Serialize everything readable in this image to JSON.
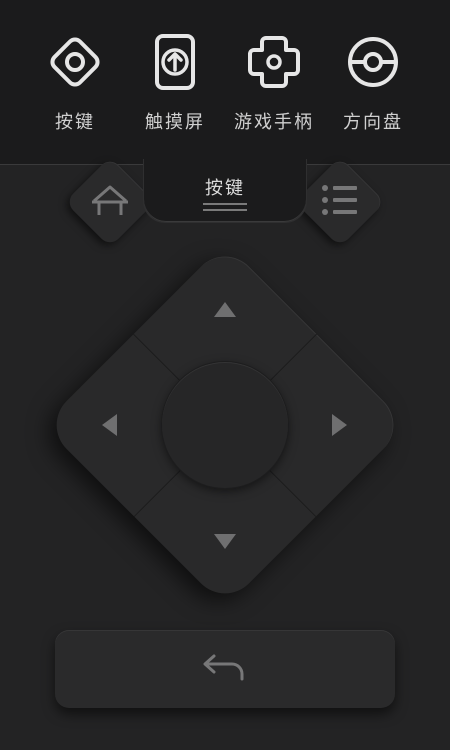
{
  "modes": [
    {
      "label": "按键",
      "icon": "diamond-target-icon"
    },
    {
      "label": "触摸屏",
      "icon": "touch-upload-icon"
    },
    {
      "label": "游戏手柄",
      "icon": "gamepad-cross-icon"
    },
    {
      "label": "方向盘",
      "icon": "steering-wheel-icon"
    }
  ],
  "active_tab": {
    "label": "按键"
  },
  "controls": {
    "home": {
      "icon": "home-icon"
    },
    "menu": {
      "icon": "menu-list-icon"
    },
    "dpad": {
      "up": "arrow-up-icon",
      "down": "arrow-down-icon",
      "left": "arrow-left-icon",
      "right": "arrow-right-icon",
      "center": "ok-button"
    },
    "back": {
      "icon": "back-arrow-icon"
    }
  },
  "colors": {
    "background": "#232324",
    "topbar": "#1b1b1c",
    "icon": "#e6e6e6",
    "arrow": "#6f6f70"
  }
}
